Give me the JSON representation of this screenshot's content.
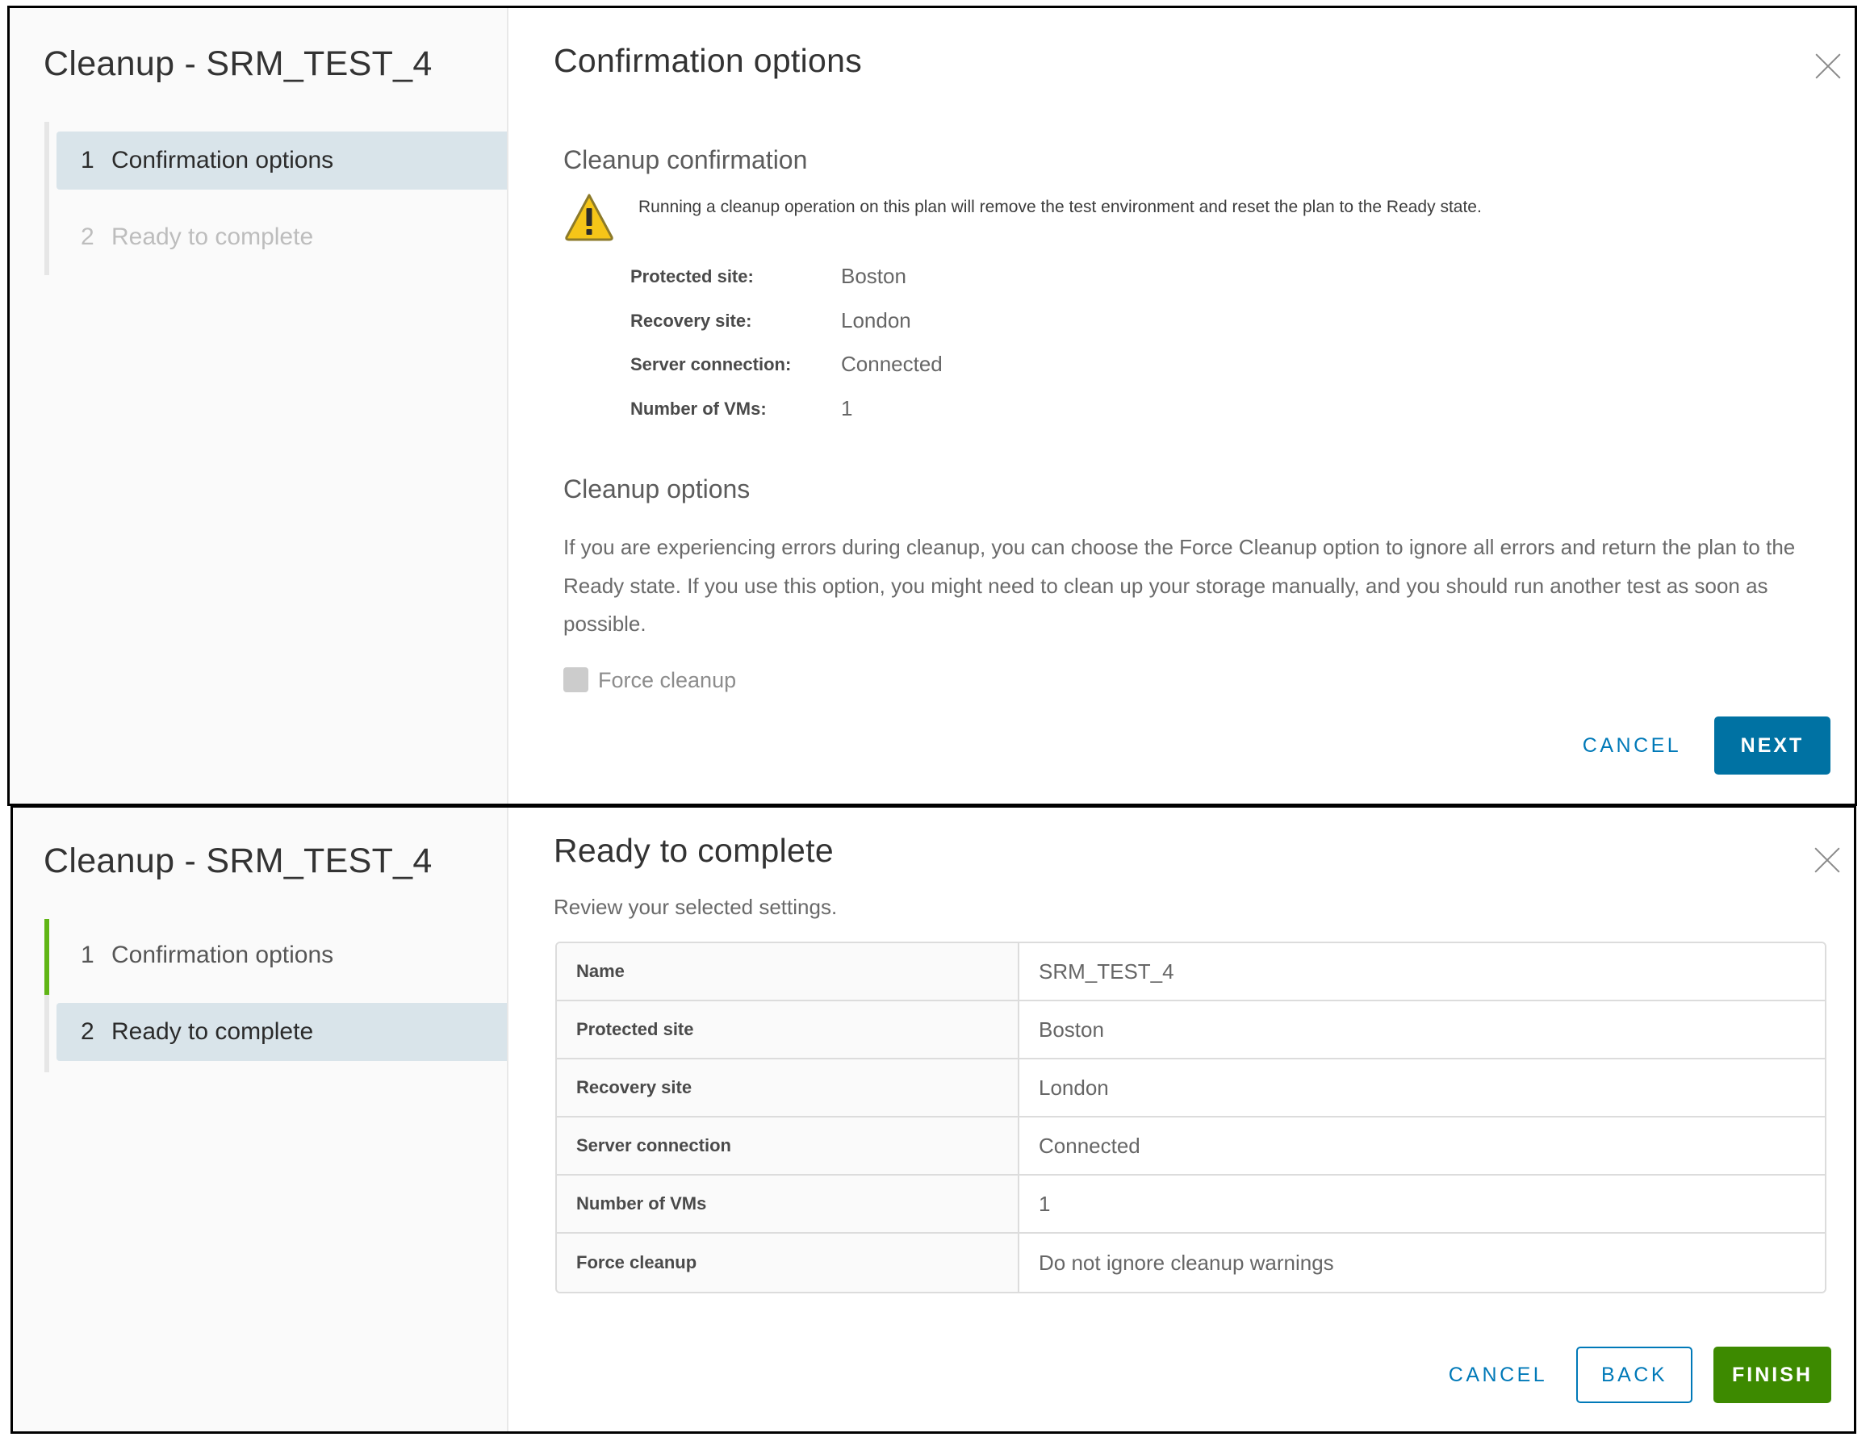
{
  "panel1": {
    "wizard_title": "Cleanup - SRM_TEST_4",
    "steps": [
      {
        "number": "1",
        "label": "Confirmation options",
        "state": "active"
      },
      {
        "number": "2",
        "label": "Ready to complete",
        "state": "disabled"
      }
    ],
    "content_title": "Confirmation options",
    "confirmation": {
      "heading": "Cleanup confirmation",
      "warning_icon": "warning-triangle-icon",
      "warning_text": "Running a cleanup operation on this plan will remove the test environment and reset the plan to the Ready state.",
      "fields": [
        {
          "label": "Protected site:",
          "value": "Boston"
        },
        {
          "label": "Recovery site:",
          "value": "London"
        },
        {
          "label": "Server connection:",
          "value": "Connected"
        },
        {
          "label": "Number of VMs:",
          "value": "1"
        }
      ]
    },
    "options": {
      "heading": "Cleanup options",
      "description": "If you are experiencing errors during cleanup, you can choose the Force Cleanup option to ignore all errors and return the plan to the Ready state. If you use this option, you might need to clean up your storage manually, and you should run another test as soon as possible.",
      "checkbox_label": "Force cleanup",
      "checkbox_checked": false
    },
    "buttons": {
      "cancel": "CANCEL",
      "next": "NEXT"
    }
  },
  "panel2": {
    "wizard_title": "Cleanup - SRM_TEST_4",
    "steps": [
      {
        "number": "1",
        "label": "Confirmation options",
        "state": "completed"
      },
      {
        "number": "2",
        "label": "Ready to complete",
        "state": "active"
      }
    ],
    "content_title": "Ready to complete",
    "subtitle": "Review your selected settings.",
    "summary": [
      {
        "key": "Name",
        "value": "SRM_TEST_4"
      },
      {
        "key": "Protected site",
        "value": "Boston"
      },
      {
        "key": "Recovery site",
        "value": "London"
      },
      {
        "key": "Server connection",
        "value": "Connected"
      },
      {
        "key": "Number of VMs",
        "value": "1"
      },
      {
        "key": "Force cleanup",
        "value": "Do not ignore cleanup warnings"
      }
    ],
    "buttons": {
      "cancel": "CANCEL",
      "back": "BACK",
      "finish": "FINISH"
    }
  },
  "colors": {
    "primary": "#0072a3",
    "link": "#0079b8",
    "success": "#3d8a00",
    "step_complete": "#60b515",
    "step_active_bg": "#d9e4ea",
    "warning": "#f5c518"
  }
}
